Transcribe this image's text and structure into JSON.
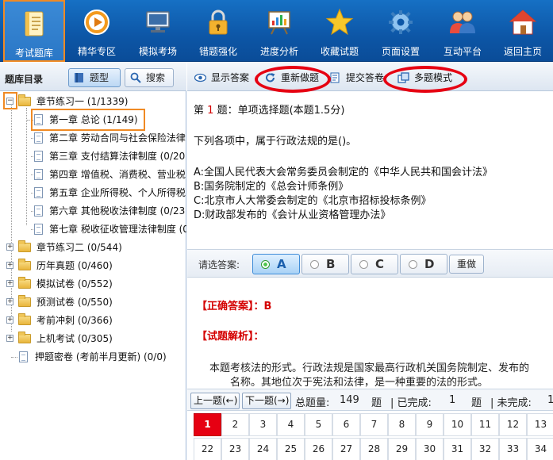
{
  "nav": {
    "items": [
      {
        "label": "考试题库",
        "icon": "notebook-icon"
      },
      {
        "label": "精华专区",
        "icon": "play-disc-icon"
      },
      {
        "label": "模拟考场",
        "icon": "monitor-icon"
      },
      {
        "label": "错题强化",
        "icon": "lock-icon"
      },
      {
        "label": "进度分析",
        "icon": "chart-board-icon"
      },
      {
        "label": "收藏试题",
        "icon": "star-icon"
      },
      {
        "label": "页面设置",
        "icon": "gear-icon"
      },
      {
        "label": "互动平台",
        "icon": "users-icon"
      },
      {
        "label": "返回主页",
        "icon": "home-icon"
      }
    ],
    "active_index": 0
  },
  "left": {
    "title": "题库目录",
    "btn_type": "题型",
    "btn_search": "搜索",
    "tree": [
      {
        "label": "章节练习一 (1/1339)",
        "level": 0,
        "kind": "folder",
        "expander": "-"
      },
      {
        "label": "第一章  总论 (1/149)",
        "level": 1,
        "kind": "doc"
      },
      {
        "label": "第二章  劳动合同与社会保险法律",
        "level": 1,
        "kind": "doc"
      },
      {
        "label": "第三章  支付结算法律制度 (0/20",
        "level": 1,
        "kind": "doc"
      },
      {
        "label": "第四章  增值税、消费税、营业税",
        "level": 1,
        "kind": "doc"
      },
      {
        "label": "第五章  企业所得税、个人所得税",
        "level": 1,
        "kind": "doc"
      },
      {
        "label": "第六章  其他税收法律制度 (0/23",
        "level": 1,
        "kind": "doc"
      },
      {
        "label": "第七章  税收征收管理法律制度 (0/",
        "level": 1,
        "kind": "doc"
      },
      {
        "label": "章节练习二 (0/544)",
        "level": 0,
        "kind": "folder",
        "expander": "+"
      },
      {
        "label": "历年真题 (0/460)",
        "level": 0,
        "kind": "folder",
        "expander": "+"
      },
      {
        "label": "模拟试卷 (0/552)",
        "level": 0,
        "kind": "folder",
        "expander": "+"
      },
      {
        "label": "预测试卷 (0/550)",
        "level": 0,
        "kind": "folder",
        "expander": "+"
      },
      {
        "label": "考前冲刺 (0/366)",
        "level": 0,
        "kind": "folder",
        "expander": "+"
      },
      {
        "label": "上机考试 (0/305)",
        "level": 0,
        "kind": "folder",
        "expander": "+"
      },
      {
        "label": "押题密卷 (考前半月更新) (0/0)",
        "level": 0,
        "kind": "doc"
      }
    ]
  },
  "toolbar": {
    "show_answer": "显示答案",
    "redo": "重新做题",
    "submit": "提交答卷",
    "multi": "多题模式"
  },
  "question": {
    "prefix": "第",
    "number": "1",
    "suffix": "题：单项选择题(本题1.5分)",
    "stem": "下列各项中，属于行政法规的是()。",
    "options": [
      "A:全国人民代表大会常务委员会制定的《中华人民共和国会计法》",
      "B:国务院制定的《总会计师条例》",
      "C:北京市人大常委会制定的《北京市招标投标条例》",
      "D:财政部发布的《会计从业资格管理办法》"
    ]
  },
  "answer_bar": {
    "label": "请选答案:",
    "choices": [
      "A",
      "B",
      "C",
      "D"
    ],
    "selected": "A",
    "redo": "重做"
  },
  "analysis": {
    "correct_label": "【正确答案】",
    "correct_sep": "：",
    "correct_value": "B",
    "analysis_label": "【试题解析】",
    "analysis_sep": "：",
    "line1": "本题考核法的形式。行政法规是国家最高行政机关国务院制定、发布的",
    "line2": "名称。其地位次于宪法和法律，是一种重要的法的形式。"
  },
  "navigation": {
    "prev": "上一题(←)",
    "next": "下一题(→)",
    "total_label": "总题量:",
    "total": "149",
    "unit1": "题",
    "done_label": "| 已完成:",
    "done": "1",
    "unit2": "题",
    "undone_label": "| 未完成:",
    "undone": "1"
  },
  "grid": {
    "row1": [
      "1",
      "2",
      "3",
      "4",
      "5",
      "6",
      "7",
      "8",
      "9",
      "10",
      "11",
      "12",
      "13"
    ],
    "row2": [
      "22",
      "23",
      "24",
      "25",
      "26",
      "27",
      "28",
      "29",
      "30",
      "31",
      "32",
      "33",
      "34"
    ],
    "current": "1"
  },
  "colors": {
    "nav_blue": "#0d56a6",
    "highlight_orange": "#f08a24",
    "annotation_red": "#e60012",
    "text_red": "#d40000"
  }
}
